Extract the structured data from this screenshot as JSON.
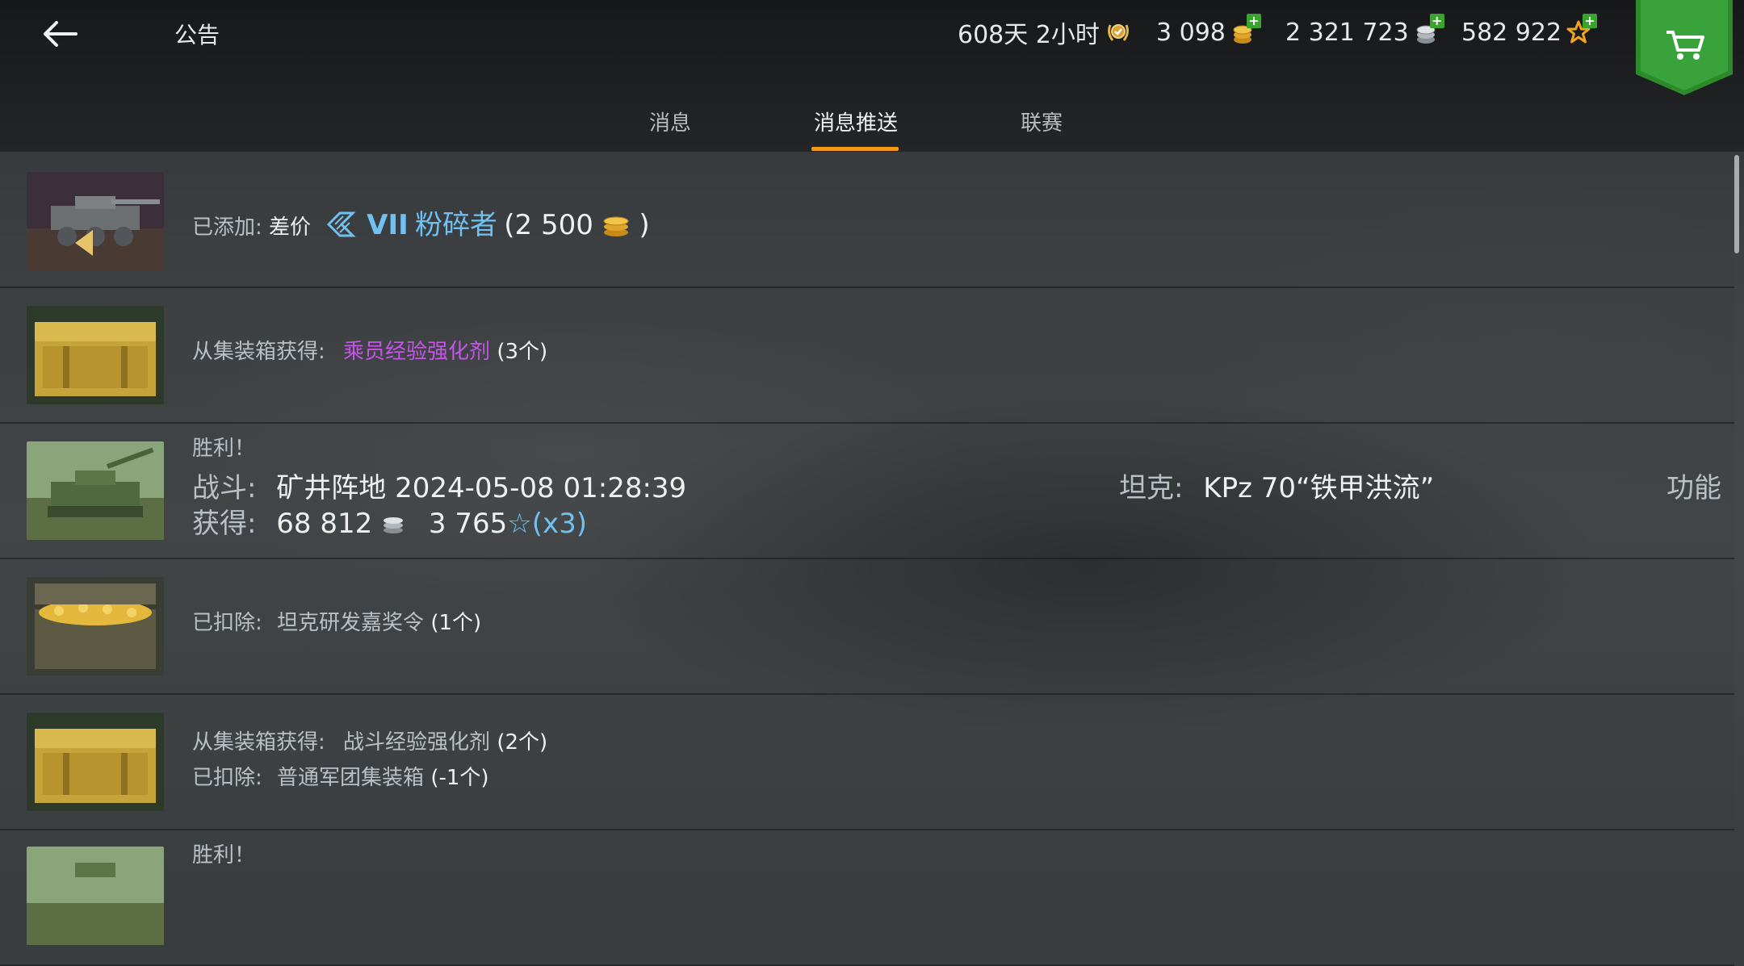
{
  "header": {
    "title": "公告",
    "premium_time": "608天 2小时",
    "gold": "3 098",
    "credits": "2 321 723",
    "free_xp": "582 922"
  },
  "tabs": [
    {
      "label": "消息"
    },
    {
      "label": "消息推送"
    },
    {
      "label": "联赛"
    }
  ],
  "active_tab": "消息推送",
  "messages": [
    {
      "prefix": "已添加:",
      "label": "差价",
      "tier": "VII",
      "tank": "粉碎者",
      "amount": "(2 500",
      "close": ")"
    },
    {
      "prefix": "从集装箱获得:",
      "item": "乘员经验强化剂",
      "count": "(3个)"
    },
    {
      "title": "胜利！",
      "battle_label": "战斗:",
      "battle_value": "矿井阵地 2024-05-08 01:28:39",
      "earn_label": "获得:",
      "credits": "68 812",
      "xp": "3 765",
      "multiplier": "(x3)",
      "tank_label": "坦克:",
      "tank_value": "KPz 70“铁甲洪流”",
      "action": "功能"
    },
    {
      "prefix": "已扣除:",
      "item": "坦克研发嘉奖令",
      "count": "(1个)"
    },
    {
      "prefix1": "从集装箱获得:",
      "item1": "战斗经验强化剂",
      "count1": "(2个)",
      "prefix2": "已扣除:",
      "item2": "普通军团集装箱",
      "count2": "(-1个)"
    },
    {
      "title": "胜利！"
    }
  ],
  "colors": {
    "accent": "#f39b17",
    "purple": "#c455e8",
    "blue": "#6fc1f2",
    "green": "#3aa52e"
  },
  "icons": {
    "back": "arrow-left-icon",
    "premium": "laurel-badge-icon",
    "gold": "gold-coins-icon",
    "credits": "silver-coins-icon",
    "free_xp": "star-icon",
    "shop": "cart-icon"
  }
}
